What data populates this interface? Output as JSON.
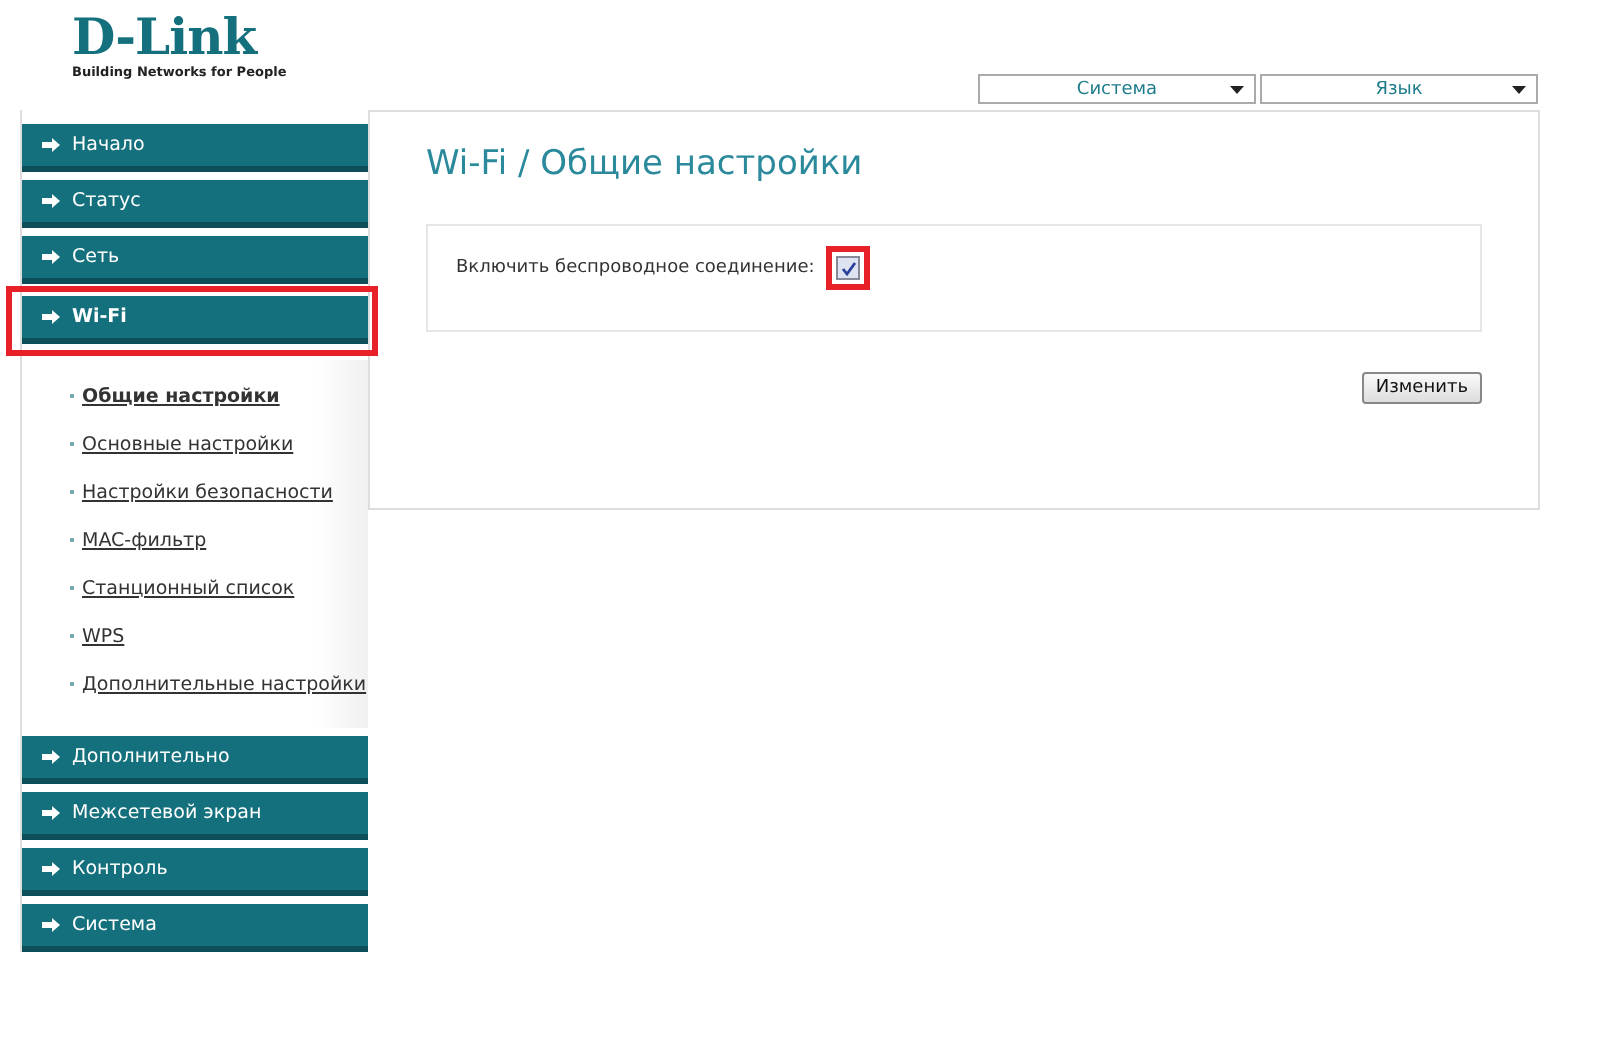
{
  "logo": {
    "name": "D-Link",
    "tagline": "Building Networks for People"
  },
  "top_menus": [
    {
      "label": "Система"
    },
    {
      "label": "Язык"
    }
  ],
  "sidebar": {
    "items": [
      {
        "label": "Начало",
        "expanded": false,
        "highlighted": false
      },
      {
        "label": "Статус",
        "expanded": false,
        "highlighted": false
      },
      {
        "label": "Сеть",
        "expanded": false,
        "highlighted": false
      },
      {
        "label": "Wi-Fi",
        "expanded": true,
        "highlighted": true,
        "children": [
          {
            "label": "Общие настройки",
            "selected": true
          },
          {
            "label": "Основные настройки",
            "selected": false
          },
          {
            "label": "Настройки безопасности",
            "selected": false
          },
          {
            "label": "MAC-фильтр",
            "selected": false
          },
          {
            "label": "Станционный список",
            "selected": false
          },
          {
            "label": "WPS",
            "selected": false
          },
          {
            "label": "Дополнительные настройки",
            "selected": false
          }
        ]
      },
      {
        "label": "Дополнительно",
        "expanded": false,
        "highlighted": false
      },
      {
        "label": "Межсетевой экран",
        "expanded": false,
        "highlighted": false
      },
      {
        "label": "Контроль",
        "expanded": false,
        "highlighted": false
      },
      {
        "label": "Система",
        "expanded": false,
        "highlighted": false
      }
    ]
  },
  "page": {
    "title": "Wi-Fi / Общие настройки",
    "fields": [
      {
        "label": "Включить беспроводное соединение:",
        "checked": true,
        "highlighted": true
      }
    ],
    "button": "Изменить"
  }
}
